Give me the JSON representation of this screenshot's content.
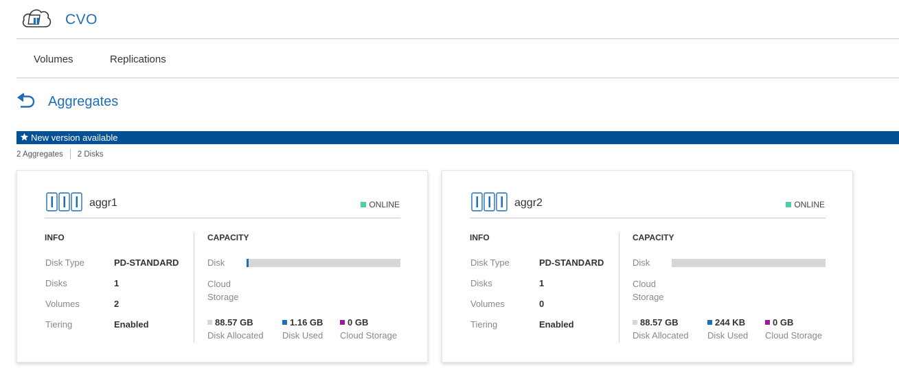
{
  "header": {
    "title": "CVO",
    "logo_icon": "cloud-storage-icon"
  },
  "nav": {
    "tabs": [
      {
        "label": "Volumes"
      },
      {
        "label": "Replications"
      }
    ]
  },
  "page": {
    "title": "Aggregates",
    "back_icon": "back-arrow-icon"
  },
  "banner": {
    "text": "New version available",
    "icon": "star-icon",
    "color": "#005196"
  },
  "summary": {
    "aggregates": "2 Aggregates",
    "disks": "2 Disks"
  },
  "colors": {
    "accent": "#1f6fb8",
    "online": "#4fcfa8",
    "disk_allocated": "#d7d7d7",
    "disk_used": "#1f6fb8",
    "cloud_storage": "#9b1b9b"
  },
  "labels": {
    "info": "INFO",
    "capacity": "CAPACITY",
    "disk_type": "Disk Type",
    "disks": "Disks",
    "volumes": "Volumes",
    "tiering": "Tiering",
    "disk": "Disk",
    "cloud_storage_line1": "Cloud",
    "cloud_storage_line2": "Storage",
    "disk_allocated": "Disk Allocated",
    "disk_used": "Disk Used",
    "cloud_storage": "Cloud Storage"
  },
  "aggregates": [
    {
      "name": "aggr1",
      "status": "ONLINE",
      "disk_type": "PD-STANDARD",
      "disks": "1",
      "volumes": "2",
      "tiering": "Enabled",
      "disk_allocated": "88.57 GB",
      "disk_used": "1.16 GB",
      "cloud_storage": "0 GB",
      "disk_used_fraction": 0.013
    },
    {
      "name": "aggr2",
      "status": "ONLINE",
      "disk_type": "PD-STANDARD",
      "disks": "1",
      "volumes": "0",
      "tiering": "Enabled",
      "disk_allocated": "88.57 GB",
      "disk_used": "244 KB",
      "cloud_storage": "0 GB",
      "disk_used_fraction": 0.0
    }
  ]
}
